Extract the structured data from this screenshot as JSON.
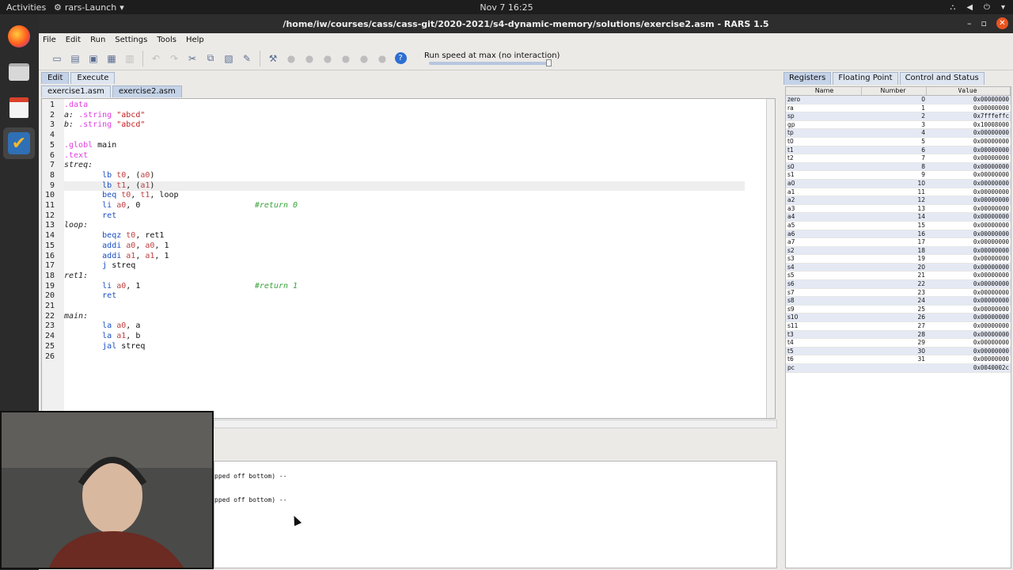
{
  "topbar": {
    "activities": "Activities",
    "app_menu": "rars-Launch",
    "clock": "Nov 7  16:25"
  },
  "window": {
    "title": "/home/iw/courses/cass/cass-git/2020-2021/s4-dynamic-memory/solutions/exercise2.asm - RARS 1.5"
  },
  "menubar": {
    "items": [
      "File",
      "Edit",
      "Run",
      "Settings",
      "Tools",
      "Help"
    ]
  },
  "toolbar": {
    "speed_label": "Run speed at max (no interaction)",
    "speed_fraction": 1.0
  },
  "left_tabs": [
    "Edit",
    "Execute"
  ],
  "file_tabs": [
    "exercise1.asm",
    "exercise2.asm"
  ],
  "editor": {
    "current_line": 9,
    "lines": [
      {
        "n": "1",
        "parts": [
          {
            "t": ".data",
            "c": "dir"
          }
        ]
      },
      {
        "n": "2",
        "parts": [
          {
            "t": "a: ",
            "c": "lbl"
          },
          {
            "t": ".string ",
            "c": "dir"
          },
          {
            "t": "\"abcd\"",
            "c": "str"
          }
        ]
      },
      {
        "n": "3",
        "parts": [
          {
            "t": "b: ",
            "c": "lbl"
          },
          {
            "t": ".string ",
            "c": "dir"
          },
          {
            "t": "\"abcd\"",
            "c": "str"
          }
        ]
      },
      {
        "n": "4",
        "parts": []
      },
      {
        "n": "5",
        "parts": [
          {
            "t": ".globl ",
            "c": "dir"
          },
          {
            "t": "main",
            "c": ""
          }
        ]
      },
      {
        "n": "6",
        "parts": [
          {
            "t": ".text",
            "c": "dir"
          }
        ]
      },
      {
        "n": "7",
        "parts": [
          {
            "t": "streq:",
            "c": "lbl"
          }
        ]
      },
      {
        "n": "8",
        "parts": [
          {
            "t": "        lb ",
            "c": "kw"
          },
          {
            "t": "t0",
            "c": "reg"
          },
          {
            "t": ", (",
            "c": ""
          },
          {
            "t": "a0",
            "c": "reg"
          },
          {
            "t": ")",
            "c": ""
          }
        ]
      },
      {
        "n": "9",
        "parts": [
          {
            "t": "        lb ",
            "c": "kw"
          },
          {
            "t": "t1",
            "c": "reg"
          },
          {
            "t": ", (",
            "c": ""
          },
          {
            "t": "a1",
            "c": "reg"
          },
          {
            "t": ")",
            "c": ""
          }
        ]
      },
      {
        "n": "10",
        "parts": [
          {
            "t": "        beq ",
            "c": "kw"
          },
          {
            "t": "t0",
            "c": "reg"
          },
          {
            "t": ", ",
            "c": ""
          },
          {
            "t": "t1",
            "c": "reg"
          },
          {
            "t": ", loop",
            "c": ""
          }
        ]
      },
      {
        "n": "11",
        "parts": [
          {
            "t": "        li ",
            "c": "kw"
          },
          {
            "t": "a0",
            "c": "reg"
          },
          {
            "t": ", 0                        ",
            "c": ""
          },
          {
            "t": "#return 0",
            "c": "cm"
          }
        ]
      },
      {
        "n": "12",
        "parts": [
          {
            "t": "        ret",
            "c": "kw"
          }
        ]
      },
      {
        "n": "13",
        "parts": [
          {
            "t": "loop:",
            "c": "lbl"
          }
        ]
      },
      {
        "n": "14",
        "parts": [
          {
            "t": "        beqz ",
            "c": "kw"
          },
          {
            "t": "t0",
            "c": "reg"
          },
          {
            "t": ", ret1",
            "c": ""
          }
        ]
      },
      {
        "n": "15",
        "parts": [
          {
            "t": "        addi ",
            "c": "kw"
          },
          {
            "t": "a0",
            "c": "reg"
          },
          {
            "t": ", ",
            "c": ""
          },
          {
            "t": "a0",
            "c": "reg"
          },
          {
            "t": ", 1",
            "c": ""
          }
        ]
      },
      {
        "n": "16",
        "parts": [
          {
            "t": "        addi ",
            "c": "kw"
          },
          {
            "t": "a1",
            "c": "reg"
          },
          {
            "t": ", ",
            "c": ""
          },
          {
            "t": "a1",
            "c": "reg"
          },
          {
            "t": ", 1",
            "c": ""
          }
        ]
      },
      {
        "n": "17",
        "parts": [
          {
            "t": "        j ",
            "c": "kw"
          },
          {
            "t": "streq",
            "c": ""
          }
        ]
      },
      {
        "n": "18",
        "parts": [
          {
            "t": "ret1:",
            "c": "lbl"
          }
        ]
      },
      {
        "n": "19",
        "parts": [
          {
            "t": "        li ",
            "c": "kw"
          },
          {
            "t": "a0",
            "c": "reg"
          },
          {
            "t": ", 1                        ",
            "c": ""
          },
          {
            "t": "#return 1",
            "c": "cm"
          }
        ]
      },
      {
        "n": "20",
        "parts": [
          {
            "t": "        ret",
            "c": "kw"
          }
        ]
      },
      {
        "n": "21",
        "parts": []
      },
      {
        "n": "22",
        "parts": [
          {
            "t": "main:",
            "c": "lbl"
          }
        ]
      },
      {
        "n": "23",
        "parts": [
          {
            "t": "        la ",
            "c": "kw"
          },
          {
            "t": "a0",
            "c": "reg"
          },
          {
            "t": ", a",
            "c": ""
          }
        ]
      },
      {
        "n": "24",
        "parts": [
          {
            "t": "        la ",
            "c": "kw"
          },
          {
            "t": "a1",
            "c": "reg"
          },
          {
            "t": ", b",
            "c": ""
          }
        ]
      },
      {
        "n": "25",
        "parts": [
          {
            "t": "        jal ",
            "c": "kw"
          },
          {
            "t": "streq",
            "c": ""
          }
        ]
      },
      {
        "n": "26",
        "parts": []
      }
    ]
  },
  "messages": {
    "lines": [
      "pped off bottom) --",
      "pped off bottom) --"
    ]
  },
  "right_tabs": [
    "Registers",
    "Floating Point",
    "Control and Status"
  ],
  "registers": {
    "headers": [
      "Name",
      "Number",
      "Value"
    ],
    "rows": [
      [
        "zero",
        "0",
        "0x00000000"
      ],
      [
        "ra",
        "1",
        "0x00000000"
      ],
      [
        "sp",
        "2",
        "0x7fffeffc"
      ],
      [
        "gp",
        "3",
        "0x10008000"
      ],
      [
        "tp",
        "4",
        "0x00000000"
      ],
      [
        "t0",
        "5",
        "0x00000000"
      ],
      [
        "t1",
        "6",
        "0x00000000"
      ],
      [
        "t2",
        "7",
        "0x00000000"
      ],
      [
        "s0",
        "8",
        "0x00000000"
      ],
      [
        "s1",
        "9",
        "0x00000000"
      ],
      [
        "a0",
        "10",
        "0x00000000"
      ],
      [
        "a1",
        "11",
        "0x00000000"
      ],
      [
        "a2",
        "12",
        "0x00000000"
      ],
      [
        "a3",
        "13",
        "0x00000000"
      ],
      [
        "a4",
        "14",
        "0x00000000"
      ],
      [
        "a5",
        "15",
        "0x00000000"
      ],
      [
        "a6",
        "16",
        "0x00000000"
      ],
      [
        "a7",
        "17",
        "0x00000000"
      ],
      [
        "s2",
        "18",
        "0x00000000"
      ],
      [
        "s3",
        "19",
        "0x00000000"
      ],
      [
        "s4",
        "20",
        "0x00000000"
      ],
      [
        "s5",
        "21",
        "0x00000000"
      ],
      [
        "s6",
        "22",
        "0x00000000"
      ],
      [
        "s7",
        "23",
        "0x00000000"
      ],
      [
        "s8",
        "24",
        "0x00000000"
      ],
      [
        "s9",
        "25",
        "0x00000000"
      ],
      [
        "s10",
        "26",
        "0x00000000"
      ],
      [
        "s11",
        "27",
        "0x00000000"
      ],
      [
        "t3",
        "28",
        "0x00000000"
      ],
      [
        "t4",
        "29",
        "0x00000000"
      ],
      [
        "t5",
        "30",
        "0x00000000"
      ],
      [
        "t6",
        "31",
        "0x00000000"
      ],
      [
        "pc",
        "",
        "0x0040002c"
      ]
    ]
  }
}
